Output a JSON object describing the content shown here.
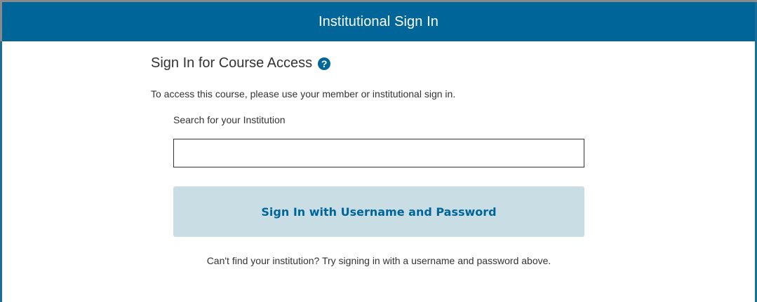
{
  "header": {
    "title": "Institutional Sign In"
  },
  "main": {
    "heading": "Sign In for Course Access",
    "help_icon_glyph": "?",
    "help_icon_name": "question-circle-icon",
    "intro": "To access this course, please use your member or institutional sign in.",
    "search": {
      "label": "Search for your Institution",
      "value": "",
      "placeholder": ""
    },
    "signin_button_label": "Sign In with Username and Password",
    "footer_note": "Can't find your institution? Try signing in with a username and password above."
  },
  "colors": {
    "header_bg": "#006699",
    "button_bg": "#c9dde5",
    "button_text": "#006699",
    "text": "#333333"
  }
}
